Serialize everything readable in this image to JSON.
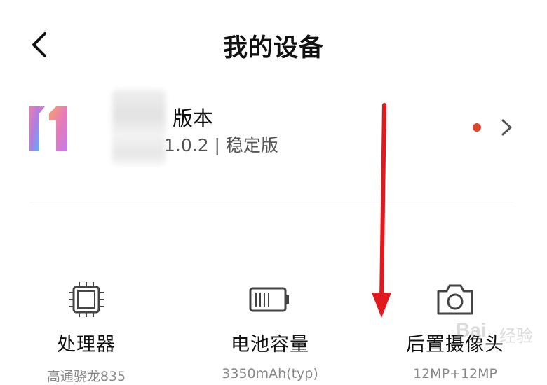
{
  "header": {
    "title": "我的设备",
    "back_icon": "chevron-left-icon"
  },
  "miui": {
    "logo_icon": "miui-11-logo",
    "name_label": "版本",
    "version_text": "1.0.2 | 稳定版",
    "update_dot_color": "#d9442b",
    "chevron_icon": "chevron-right-icon"
  },
  "specs": [
    {
      "icon": "processor-icon",
      "name": "处理器",
      "value": "高通骁龙835"
    },
    {
      "icon": "battery-icon",
      "name": "电池容量",
      "value": "3350mAh(typ)"
    },
    {
      "icon": "camera-icon",
      "name": "后置摄像头",
      "value": "12MP+12MP"
    }
  ],
  "annotation": {
    "arrow_color": "#e0191e"
  },
  "watermark": {
    "text": "Bai",
    "sub": "经验"
  }
}
